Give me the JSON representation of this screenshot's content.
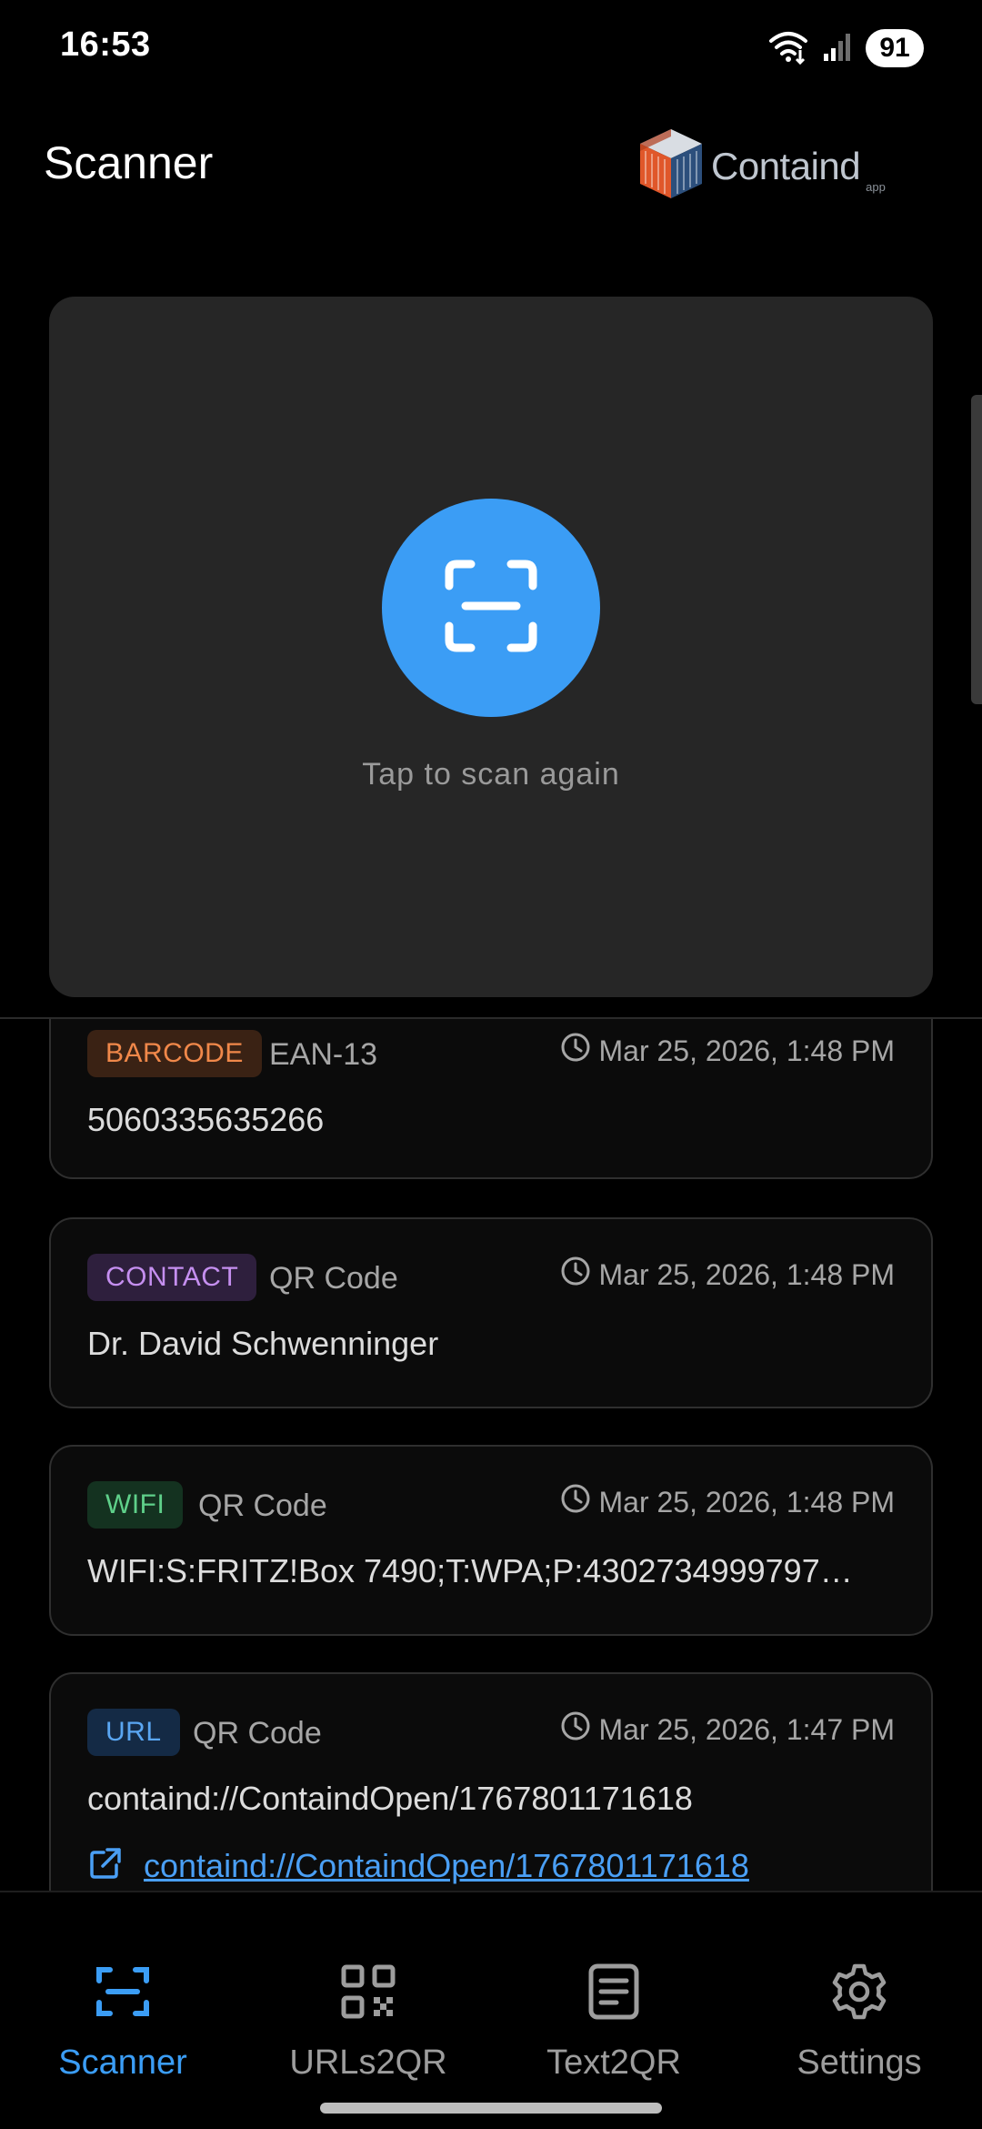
{
  "status_bar": {
    "time": "16:53",
    "battery": "91",
    "icons": [
      "wifi-icon",
      "signal-icon",
      "battery-icon"
    ]
  },
  "header": {
    "title": "Scanner",
    "brand": "Containd",
    "brand_tld": "app"
  },
  "scan_panel": {
    "icon": "scan-frame-icon",
    "hint": "Tap to scan again"
  },
  "history": [
    {
      "tag": "BARCODE",
      "tag_color": "#f0884a",
      "tag_bg": "#3a2214",
      "format": "EAN-13",
      "time": "Mar 25, 2026, 1:48 PM",
      "content": "5060335635266"
    },
    {
      "tag": "CONTACT",
      "tag_color": "#c58ff0",
      "tag_bg": "#2e1f3d",
      "format": "QR Code",
      "time": "Mar 25, 2026, 1:48 PM",
      "content": "Dr. David Schwenninger"
    },
    {
      "tag": "WIFI",
      "tag_color": "#5fd08a",
      "tag_bg": "#143220",
      "format": "QR Code",
      "time": "Mar 25, 2026, 1:48 PM",
      "content": "WIFI:S:FRITZ!Box 7490;T:WPA;P:4302734999797…"
    },
    {
      "tag": "URL",
      "tag_color": "#5aa6f2",
      "tag_bg": "#142a45",
      "format": "QR Code",
      "time": "Mar 25, 2026, 1:47 PM",
      "content": "containd://ContaindOpen/1767801171618",
      "link": "containd://ContaindOpen/1767801171618"
    }
  ],
  "nav": {
    "active": "Scanner",
    "accent": "#3b9df5",
    "items": [
      {
        "label": "Scanner",
        "icon": "scan-frame-icon"
      },
      {
        "label": "URLs2QR",
        "icon": "qr-grid-icon"
      },
      {
        "label": "Text2QR",
        "icon": "document-icon"
      },
      {
        "label": "Settings",
        "icon": "gear-icon"
      }
    ]
  }
}
